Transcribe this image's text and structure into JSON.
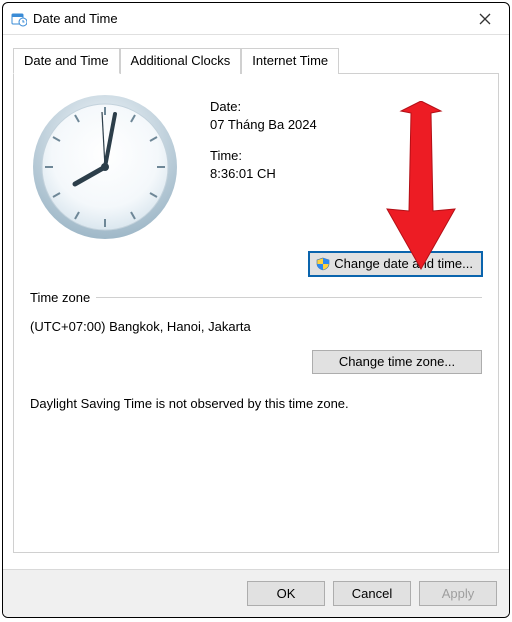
{
  "window": {
    "title": "Date and Time"
  },
  "tabs": {
    "dateTime": "Date and Time",
    "additionalClocks": "Additional Clocks",
    "internetTime": "Internet Time"
  },
  "datetime": {
    "dateLabel": "Date:",
    "dateValue": "07 Tháng Ba 2024",
    "timeLabel": "Time:",
    "timeValue": "8:36:01 CH",
    "changeButton": "Change date and time..."
  },
  "timezone": {
    "heading": "Time zone",
    "value": "(UTC+07:00) Bangkok, Hanoi, Jakarta",
    "changeButton": "Change time zone...",
    "dstNote": "Daylight Saving Time is not observed by this time zone."
  },
  "footer": {
    "ok": "OK",
    "cancel": "Cancel",
    "apply": "Apply"
  }
}
